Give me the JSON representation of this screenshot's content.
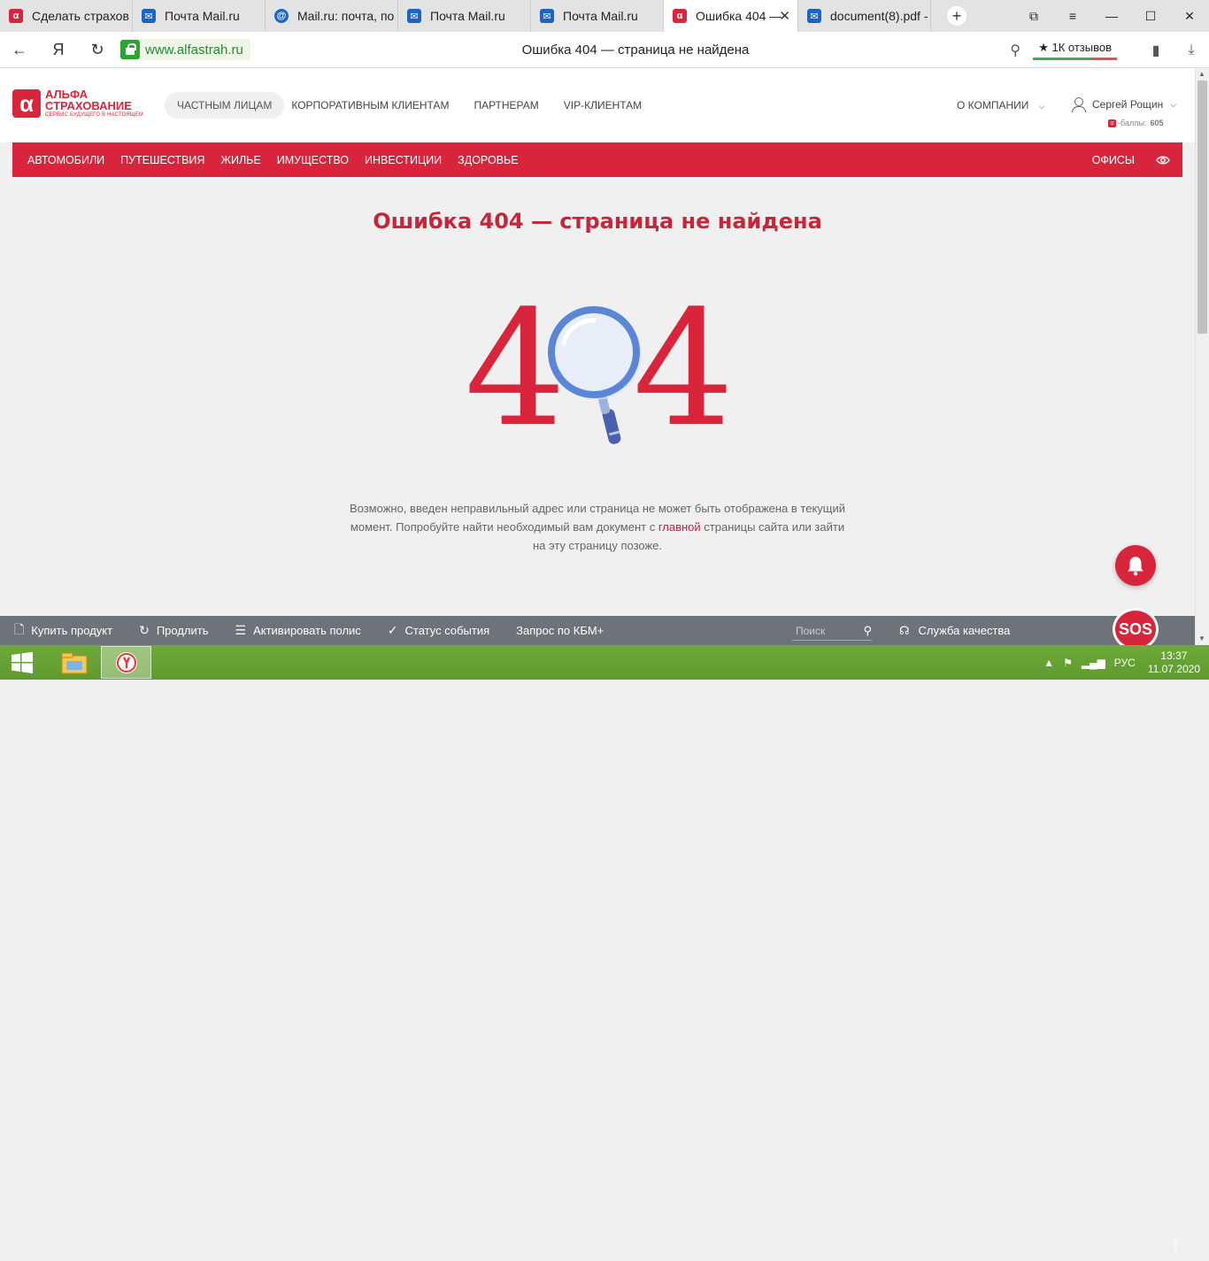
{
  "browser": {
    "tabs": [
      {
        "title": "Сделать страховку",
        "favicon": "alfa-icon",
        "active": false
      },
      {
        "title": "Почта Mail.ru",
        "favicon": "mail-icon",
        "active": false
      },
      {
        "title": "Mail.ru: почта, поиск",
        "favicon": "mailru-icon",
        "active": false
      },
      {
        "title": "Почта Mail.ru",
        "favicon": "mail-icon",
        "active": false
      },
      {
        "title": "Почта Mail.ru",
        "favicon": "mail-icon",
        "active": false
      },
      {
        "title": "Ошибка 404 —",
        "favicon": "alfa-icon",
        "active": true
      },
      {
        "title": "document(8).pdf -",
        "favicon": "mail-icon",
        "active": false
      }
    ],
    "url": "www.alfastrah.ru",
    "page_title": "Ошибка 404 — страница не найдена",
    "reviews": "1К отзывов",
    "yandex_glyph": "Я"
  },
  "site": {
    "logo": {
      "line1": "АЛЬФА",
      "line2": "СТРАХОВАНИЕ",
      "tagline": "СЕРВИС БУДУЩЕГО В НАСТОЯЩЕМ",
      "mark": "α"
    },
    "segments": [
      "ЧАСТНЫМ ЛИЦАМ",
      "КОРПОРАТИВНЫМ КЛИЕНТАМ",
      "ПАРТНЕРАМ",
      "VIP-КЛИЕНТАМ"
    ],
    "about": "О КОМПАНИИ",
    "user_name": "Сергей Рощин",
    "bonus_label": "-баллы:",
    "bonus_value": "605",
    "categories": [
      "АВТОМОБИЛИ",
      "ПУТЕШЕСТВИЯ",
      "ЖИЛЬЕ",
      "ИМУЩЕСТВО",
      "ИНВЕСТИЦИИ",
      "ЗДОРОВЬЕ"
    ],
    "offices": "ОФИСЫ",
    "accent_color": "#d9253b"
  },
  "error": {
    "title": "Ошибка 404 — страница не найдена",
    "digit_left": "4",
    "digit_right": "4",
    "text_before": "Возможно, введен неправильный адрес или страница не может быть отображена в текущий момент. Попробуйте найти необходимый вам документ с ",
    "link_text": "главной",
    "text_after": " страницы сайта или зайти на эту страницу позоже."
  },
  "bottombar": {
    "items": [
      "Купить продукт",
      "Продлить",
      "Активировать полис",
      "Статус события",
      "Запрос по КБМ+"
    ],
    "search_placeholder": "Поиск",
    "quality": "Служба качества",
    "sos": "SOS"
  },
  "taskbar": {
    "lang": "РУС",
    "time": "13:37",
    "date": "11.07.2020"
  }
}
